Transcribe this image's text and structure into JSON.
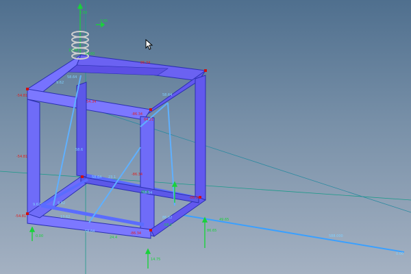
{
  "viewport": {
    "name": "3d-structural-view"
  },
  "labels": {
    "top_axis": "2.50",
    "top_axis_b": "0.95",
    "spring_a": "13.98",
    "spring_b": "14.60",
    "top_red_right": "86.34",
    "left_red_top": "-54.81",
    "top_front_red": "54.34",
    "front_right_red": "-86.34",
    "corner_red": "64.21",
    "mid_left_red": "-54.81",
    "bottom_left_red": "-54.81",
    "bottom_front_red": "-86.34",
    "bottom_mid_red": "-86.34",
    "right_bottom_red": "-86.34",
    "blue_top_left": "58.64",
    "blue_top_right": "58.64",
    "blue_top_mid": "9.62",
    "blue_mid": "58.6",
    "blue_diag": "58.64",
    "blue_left": "9.62",
    "blue_lower_left": "9.62",
    "blue_bottom": "13.62",
    "blue_bottom_mid": "58.64",
    "blue_right": "58.64",
    "blue_corner": "23.1",
    "blue_cable_start": "86.82",
    "blue_far": "588.000",
    "blue_end": "0.00",
    "green_corner": "49.65",
    "green_floor_mid": "24.4",
    "green_left_arrow": "0.00",
    "green_right_arrow": "86.65",
    "green_bottom_arrow": "14.75",
    "green_mid_right": "65.6",
    "green_mid_right2": "-58.2"
  }
}
